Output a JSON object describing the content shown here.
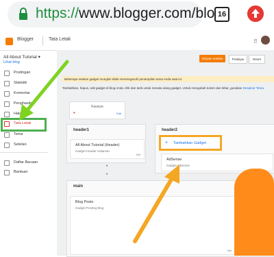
{
  "browser": {
    "url_scheme": "https://",
    "url_rest": "www.blogger.com/blo",
    "tab_count": "16"
  },
  "header": {
    "app_name": "Blogger",
    "page_name": "Tata Letak"
  },
  "sidebar": {
    "blog_select": "All About Tutorial ▾",
    "view_blog": "Lihat blog",
    "items": [
      {
        "label": "Postingan"
      },
      {
        "label": "Statistik"
      },
      {
        "label": "Komentar"
      },
      {
        "label": "Penghasilan"
      },
      {
        "label": "Halaman"
      },
      {
        "label": "Tata Letak"
      },
      {
        "label": "Tema"
      },
      {
        "label": "Setelan"
      },
      {
        "label": "Daftar Bacaan"
      },
      {
        "label": "Bantuan"
      }
    ],
    "active_index": 5
  },
  "toolbar": {
    "save": "Simpan setelan",
    "preview": "Pratinjau",
    "reset": "Reset"
  },
  "notices": {
    "warning": "Beberapa setelan gadget mungkin tidak memengaruhi penampilan tema Anda saat ini.",
    "info": "Tambahkan, hapus, edit gadget di blog Anda. Klik dan tarik untuk menata ulang gadget. Untuk mengubah kolom dan lebar, gunakan",
    "info_link": "Desainer Tema."
  },
  "layout": {
    "favicon": {
      "title": "Favicon",
      "edit": "Edit"
    },
    "header1": {
      "title": "header1",
      "gadget_title": "All About Tutorial (Header)",
      "gadget_sub": "Gadget Header Halaman",
      "edit": "Edit"
    },
    "header2": {
      "title": "header2",
      "add_gadget": "Tambahkan Gadget",
      "gadget_title": "AdSense",
      "gadget_sub": "Gadget AdSense"
    },
    "main": {
      "title": "main",
      "gadget_title": "Blog Posts",
      "gadget_sub": "Gadget Posting Blog",
      "edit": "Edit"
    }
  },
  "colors": {
    "arrow_green": "#7ed321",
    "arrow_orange": "#f5a623",
    "highlight_green": "#4caf50",
    "blogger_orange": "#f57c00"
  }
}
